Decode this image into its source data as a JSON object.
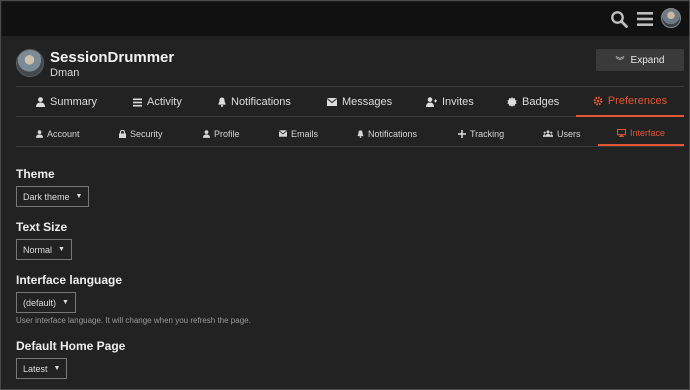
{
  "header": {
    "search_icon": "search-icon",
    "menu_icon": "hamburger-menu-icon",
    "avatar_icon": "user-avatar"
  },
  "profile": {
    "username": "SessionDrummer",
    "display_name": "Dman",
    "expand_label": "Expand",
    "expand_icon": "double-chevron-down-icon"
  },
  "main_tabs": [
    {
      "label": "Summary",
      "icon": "user-icon"
    },
    {
      "label": "Activity",
      "icon": "list-icon"
    },
    {
      "label": "Notifications",
      "icon": "bell-icon"
    },
    {
      "label": "Messages",
      "icon": "envelope-icon"
    },
    {
      "label": "Invites",
      "icon": "user-plus-icon"
    },
    {
      "label": "Badges",
      "icon": "certificate-icon"
    },
    {
      "label": "Preferences",
      "icon": "gear-icon",
      "active": true
    }
  ],
  "sub_tabs": [
    {
      "label": "Account",
      "icon": "user-icon"
    },
    {
      "label": "Security",
      "icon": "lock-icon"
    },
    {
      "label": "Profile",
      "icon": "user-icon"
    },
    {
      "label": "Emails",
      "icon": "envelope-icon"
    },
    {
      "label": "Notifications",
      "icon": "bell-icon"
    },
    {
      "label": "Tracking",
      "icon": "plus-icon"
    },
    {
      "label": "Users",
      "icon": "users-icon"
    },
    {
      "label": "Interface",
      "icon": "desktop-icon",
      "active": true
    }
  ],
  "settings": {
    "theme": {
      "label": "Theme",
      "value": "Dark theme"
    },
    "text_size": {
      "label": "Text Size",
      "value": "Normal"
    },
    "interface_language": {
      "label": "Interface language",
      "value": "(default)",
      "help": "User interface language. It will change when you refresh the page."
    },
    "default_home_page": {
      "label": "Default Home Page",
      "value": "Latest"
    }
  },
  "colors": {
    "accent": "#e45735",
    "background": "#222222",
    "topbar": "#111111"
  }
}
